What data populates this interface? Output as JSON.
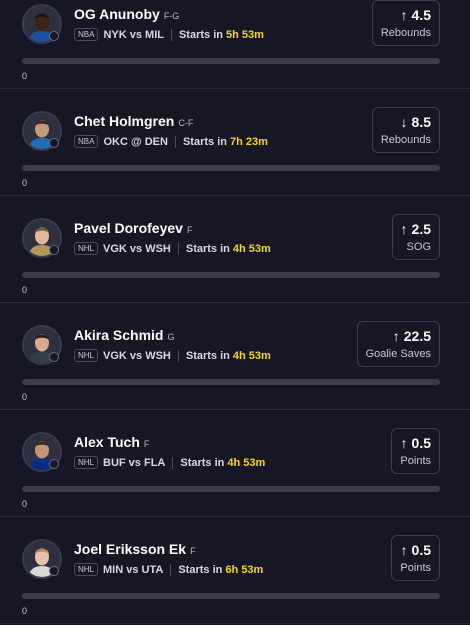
{
  "players": [
    {
      "name": "OG Anunoby",
      "position": "F-G",
      "league": "NBA",
      "matchup": "NYK vs MIL",
      "starts_label": "Starts in",
      "countdown": "5h 53m",
      "direction": "up",
      "arrow": "↑",
      "line": "4.5",
      "stat": "Rebounds",
      "progress": 0,
      "progress_text": "0",
      "jersey_color": "#1d4fa3",
      "skin": "#3b2418",
      "hair": "#1a1210"
    },
    {
      "name": "Chet Holmgren",
      "position": "C-F",
      "league": "NBA",
      "matchup": "OKC @ DEN",
      "starts_label": "Starts in",
      "countdown": "7h 23m",
      "direction": "down",
      "arrow": "↓",
      "line": "8.5",
      "stat": "Rebounds",
      "progress": 0,
      "progress_text": "0",
      "jersey_color": "#1f6fb8",
      "skin": "#c99a7a",
      "hair": "#3a2516"
    },
    {
      "name": "Pavel Dorofeyev",
      "position": "F",
      "league": "NHL",
      "matchup": "VGK vs WSH",
      "starts_label": "Starts in",
      "countdown": "4h 53m",
      "direction": "up",
      "arrow": "↑",
      "line": "2.5",
      "stat": "SOG",
      "progress": 0,
      "progress_text": "0",
      "jersey_color": "#b4975a",
      "skin": "#e0b89a",
      "hair": "#7a5c3a"
    },
    {
      "name": "Akira Schmid",
      "position": "G",
      "league": "NHL",
      "matchup": "VGK vs WSH",
      "starts_label": "Starts in",
      "countdown": "4h 53m",
      "direction": "up",
      "arrow": "↑",
      "line": "22.5",
      "stat": "Goalie Saves",
      "progress": 0,
      "progress_text": "0",
      "jersey_color": "#333f48",
      "skin": "#d8a98a",
      "hair": "#2a1c12"
    },
    {
      "name": "Alex Tuch",
      "position": "F",
      "league": "NHL",
      "matchup": "BUF vs FLA",
      "starts_label": "Starts in",
      "countdown": "4h 53m",
      "direction": "up",
      "arrow": "↑",
      "line": "0.5",
      "stat": "Points",
      "progress": 0,
      "progress_text": "0",
      "jersey_color": "#003087",
      "skin": "#c99475",
      "hair": "#3a2a1a"
    },
    {
      "name": "Joel Eriksson Ek",
      "position": "F",
      "league": "NHL",
      "matchup": "MIN vs UTA",
      "starts_label": "Starts in",
      "countdown": "6h 53m",
      "direction": "up",
      "arrow": "↑",
      "line": "0.5",
      "stat": "Points",
      "progress": 0,
      "progress_text": "0",
      "jersey_color": "#d8d8d8",
      "skin": "#e6c2a6",
      "hair": "#b88a50"
    }
  ]
}
